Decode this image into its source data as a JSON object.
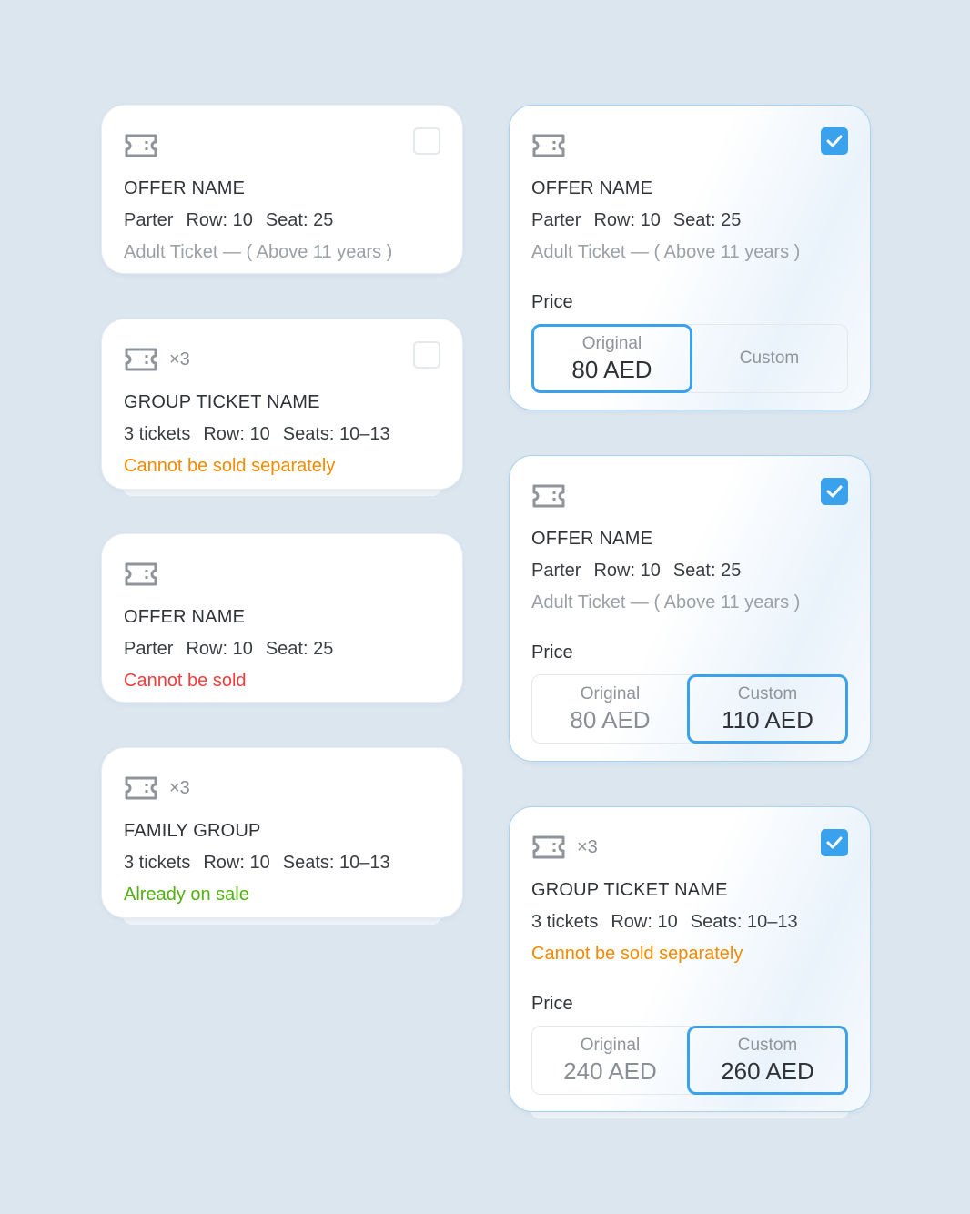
{
  "colors": {
    "background": "#dce6ef",
    "accent": "#3aa2ec",
    "warning": "#f28a00",
    "error": "#f03e3e",
    "success": "#52b012"
  },
  "left": [
    {
      "count": "",
      "title": "OFFER NAME",
      "section": "Parter",
      "row": "Row: 10",
      "seat": "Seat: 25",
      "note": "Adult Ticket — ( Above 11 years )",
      "note_color": "grey",
      "checkbox": "unchecked"
    },
    {
      "count": "×3",
      "title": "GROUP TICKET NAME",
      "section": "3 tickets",
      "row": "Row: 10",
      "seat": "Seats: 10–13",
      "note": "Cannot be sold separately",
      "note_color": "orange",
      "checkbox": "unchecked"
    },
    {
      "count": "",
      "title": "OFFER NAME",
      "section": "Parter",
      "row": "Row: 10",
      "seat": "Seat: 25",
      "note": "Cannot be sold",
      "note_color": "red",
      "checkbox": "none"
    },
    {
      "count": "×3",
      "title": "FAMILY GROUP",
      "section": "3 tickets",
      "row": "Row: 10",
      "seat": "Seats: 10–13",
      "note": "Already on sale",
      "note_color": "green",
      "checkbox": "none"
    }
  ],
  "right": [
    {
      "count": "",
      "title": "OFFER NAME",
      "section": "Parter",
      "row": "Row: 10",
      "seat": "Seat: 25",
      "note": "Adult Ticket — ( Above 11 years )",
      "note_color": "grey",
      "checkbox": "checked",
      "price_label": "Price",
      "original_label": "Original",
      "original_value": "80 AED",
      "custom_label": "Custom",
      "custom_value": "",
      "active": "original"
    },
    {
      "count": "",
      "title": "OFFER NAME",
      "section": "Parter",
      "row": "Row: 10",
      "seat": "Seat: 25",
      "note": "Adult Ticket — ( Above 11 years )",
      "note_color": "grey",
      "checkbox": "checked",
      "price_label": "Price",
      "original_label": "Original",
      "original_value": "80 AED",
      "custom_label": "Custom",
      "custom_value": "110 AED",
      "active": "custom"
    },
    {
      "count": "×3",
      "title": "GROUP TICKET NAME",
      "section": "3 tickets",
      "row": "Row: 10",
      "seat": "Seats: 10–13",
      "note": "Cannot be sold separately",
      "note_color": "orange",
      "checkbox": "checked",
      "price_label": "Price",
      "original_label": "Original",
      "original_value": "240 AED",
      "custom_label": "Custom",
      "custom_value": "260 AED",
      "active": "custom"
    }
  ]
}
